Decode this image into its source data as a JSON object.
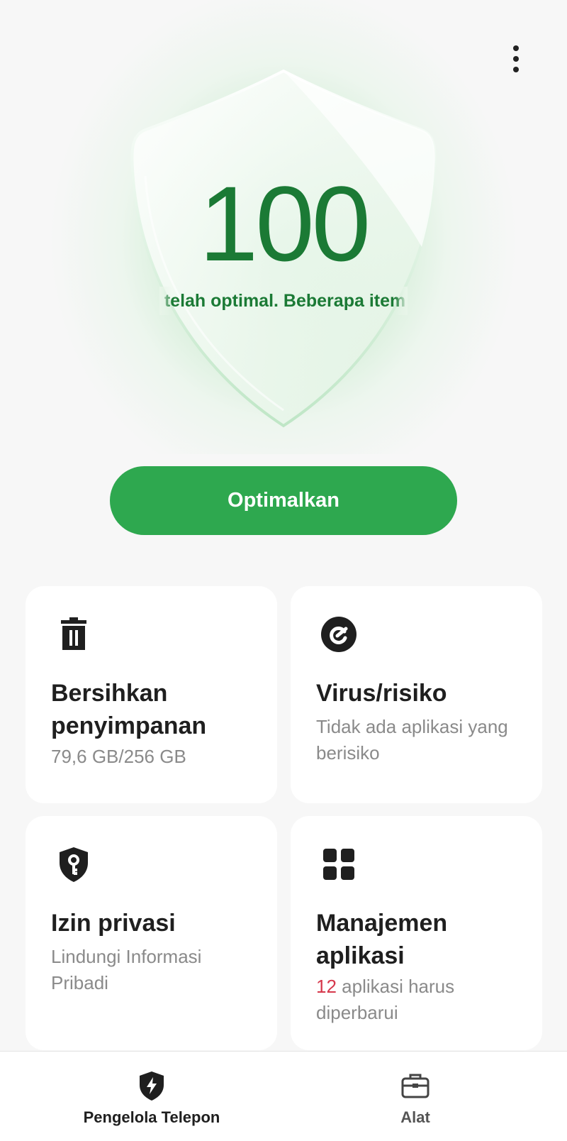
{
  "header": {
    "menu_icon": "more-vertical-icon"
  },
  "score": {
    "value": "100",
    "status": "a telah optimal. Beberapa item",
    "colors": {
      "score": "#1b7a35",
      "glow": "#4ac767"
    }
  },
  "primary_action": {
    "label": "Optimalkan",
    "color": "#2ea84f"
  },
  "cards": [
    {
      "icon": "trash-icon",
      "title": "Bersihkan penyimpanan",
      "subtitle": "79,6 GB/256 GB"
    },
    {
      "icon": "virus-scan-icon",
      "title": "Virus/risiko",
      "subtitle": "Tidak ada aplikasi yang berisiko"
    },
    {
      "icon": "privacy-shield-key-icon",
      "title": "Izin privasi",
      "subtitle": "Lindungi Informasi Pribadi"
    },
    {
      "icon": "app-grid-icon",
      "title": "Manajemen aplikasi",
      "subtitle_count": "12",
      "subtitle_rest": " aplikasi harus diperbarui",
      "count_color": "#d6384c"
    }
  ],
  "bottom_nav": [
    {
      "icon": "shield-bolt-icon",
      "label": "Pengelola Telepon",
      "active": true
    },
    {
      "icon": "toolbox-icon",
      "label": "Alat",
      "active": false
    }
  ]
}
